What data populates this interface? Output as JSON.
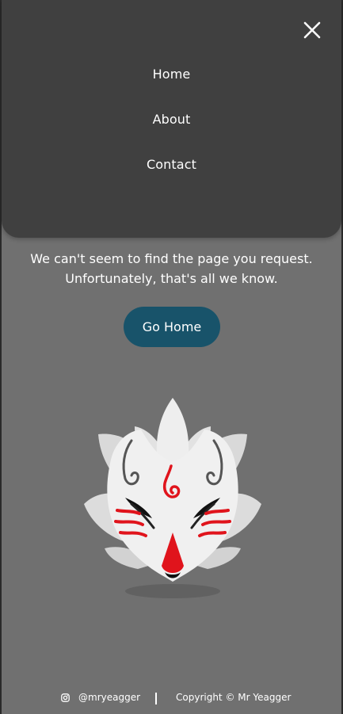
{
  "nav": {
    "items": [
      {
        "label": "Home"
      },
      {
        "label": "About"
      },
      {
        "label": "Contact"
      }
    ],
    "close_icon": "close-icon"
  },
  "main": {
    "message_line1": "We can't seem to find the page you request.",
    "message_line2": "Unfortunately, that's all we know.",
    "go_home_label": "Go Home",
    "illustration": "kitsune-fox-mask"
  },
  "footer": {
    "instagram_icon": "instagram-icon",
    "handle": "@mryeagger",
    "copyright": "Copyright © Mr Yeagger"
  },
  "colors": {
    "page_background": "#707070",
    "menu_background": "#404040",
    "button_background": "#18536a",
    "text": "#ffffff",
    "accent_red": "#e0141c"
  }
}
